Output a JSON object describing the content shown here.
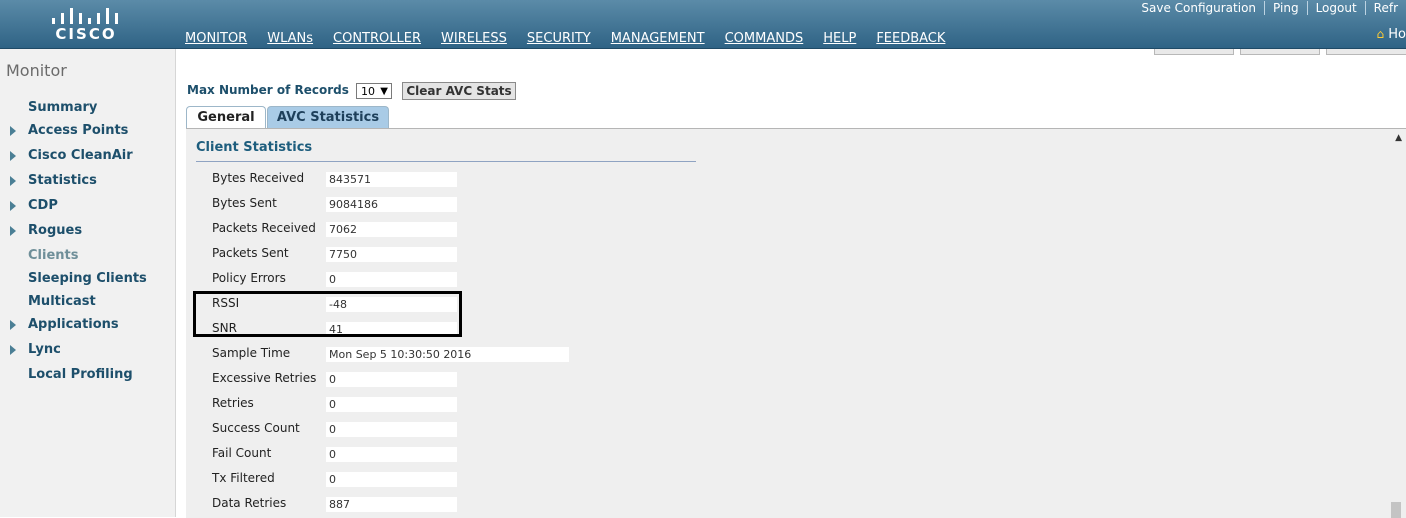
{
  "brand": {
    "logo_text": "CISCO"
  },
  "top_links": [
    "Save Configuration",
    "Ping",
    "Logout",
    "Refr"
  ],
  "main_nav": [
    "MONITOR",
    "WLANs",
    "CONTROLLER",
    "WIRELESS",
    "SECURITY",
    "MANAGEMENT",
    "COMMANDS",
    "HELP",
    "FEEDBACK"
  ],
  "home_label": "Ho",
  "sidebar": {
    "title": "Monitor",
    "items": [
      {
        "label": "Summary",
        "expandable": false,
        "active": false
      },
      {
        "label": "Access Points",
        "expandable": true,
        "active": false
      },
      {
        "label": "Cisco CleanAir",
        "expandable": true,
        "active": false
      },
      {
        "label": "Statistics",
        "expandable": true,
        "active": false
      },
      {
        "label": "CDP",
        "expandable": true,
        "active": false
      },
      {
        "label": "Rogues",
        "expandable": true,
        "active": false
      },
      {
        "label": "Clients",
        "expandable": false,
        "active": true
      },
      {
        "label": "Sleeping Clients",
        "expandable": false,
        "active": false
      },
      {
        "label": "Multicast",
        "expandable": false,
        "active": false
      },
      {
        "label": "Applications",
        "expandable": true,
        "active": false
      },
      {
        "label": "Lync",
        "expandable": true,
        "active": false
      },
      {
        "label": "Local Profiling",
        "expandable": false,
        "active": false
      }
    ]
  },
  "controls": {
    "max_records_label": "Max Number of Records",
    "max_records_value": "10",
    "clear_button": "Clear AVC Stats"
  },
  "tabs": [
    {
      "label": "General",
      "selected": true
    },
    {
      "label": "AVC Statistics",
      "selected": false
    }
  ],
  "client_statistics": {
    "title": "Client Statistics",
    "rows": [
      {
        "label": "Bytes Received",
        "value": "843571"
      },
      {
        "label": "Bytes Sent",
        "value": "9084186"
      },
      {
        "label": "Packets Received",
        "value": "7062"
      },
      {
        "label": "Packets Sent",
        "value": "7750"
      },
      {
        "label": "Policy Errors",
        "value": "0"
      },
      {
        "label": "RSSI",
        "value": "-48"
      },
      {
        "label": "SNR",
        "value": "41"
      },
      {
        "label": "Sample Time",
        "value": "Mon Sep  5 10:30:50 2016"
      },
      {
        "label": "Excessive Retries",
        "value": "0"
      },
      {
        "label": "Retries",
        "value": "0"
      },
      {
        "label": "Success Count",
        "value": "0"
      },
      {
        "label": "Fail Count",
        "value": "0"
      },
      {
        "label": "Tx Filtered",
        "value": "0"
      },
      {
        "label": "Data Retries",
        "value": "887"
      }
    ]
  },
  "colors": {
    "topbar": "#2f6385",
    "nav_text": "#1d4f6b",
    "active_tab_bg": "#a9cbe6"
  }
}
